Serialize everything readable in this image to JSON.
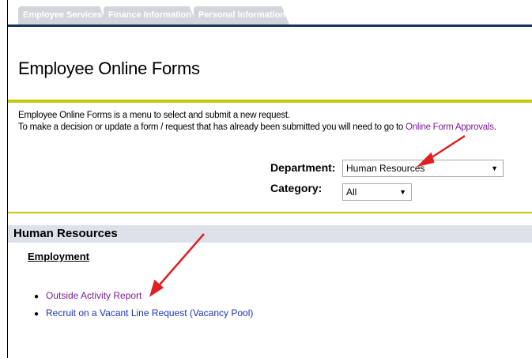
{
  "tabs": [
    {
      "label": "Employee Services"
    },
    {
      "label": "Finance Information"
    },
    {
      "label": "Personal Information"
    }
  ],
  "page": {
    "title": "Employee Online Forms",
    "intro_line1": "Employee Online Forms is a menu to select and submit a new request.",
    "intro_line2_prefix": "To make a decision or update a form / request that has already been submitted you will need to go to ",
    "intro_link": "Online Form Approvals",
    "intro_line2_suffix": "."
  },
  "filters": {
    "department_label": "Department:",
    "department_value": "Human Resources",
    "category_label": "Category:",
    "category_value": "All"
  },
  "section": {
    "title": "Human Resources",
    "subsection": "Employment",
    "items": [
      {
        "label": "Outside Activity Report"
      },
      {
        "label": "Recruit on a Vacant Line Request (Vacancy Pool)"
      }
    ]
  },
  "colors": {
    "nav_bar": "#14365e",
    "accent_bar": "#c8c80a",
    "visited_link": "#7d1d96",
    "link": "#1c36b4",
    "annotation_arrow": "#e02020"
  }
}
